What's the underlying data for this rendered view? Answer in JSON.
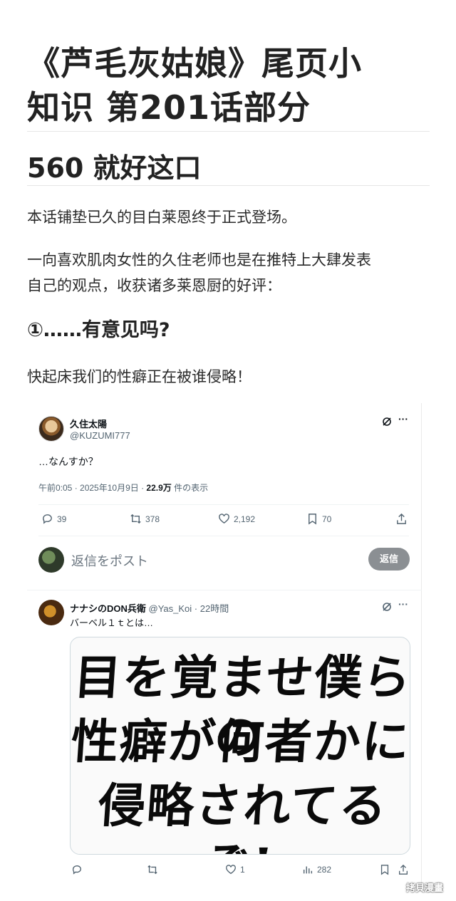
{
  "article": {
    "title_line1": "《芦毛灰姑娘》尾页小",
    "title_line2": "知识 第201话部分",
    "section_heading": "560 就好这口",
    "para1": "本话铺垫已久的目白莱恩终于正式登场。",
    "para2_line1": "一向喜欢肌肉女性的久住老师也是在推特上大肆发表",
    "para2_line2": "自己的观点，收获诸多莱恩厨的好评：",
    "sub_heading": "①……有意见吗?",
    "para3": "快起床我们的性癖正在被谁侵略！"
  },
  "tweet": {
    "author_name": "久住太陽",
    "author_handle": "@KUZUMI777",
    "text": "…なんすか？",
    "meta_time": "午前0:05 · 2025年10月9日 · ",
    "views": "22.9万",
    "views_suffix": " 件の表示",
    "replies": "39",
    "retweets": "378",
    "likes": "2,192",
    "bookmarks": "70",
    "reply_placeholder": "返信をポスト",
    "reply_button": "返信"
  },
  "reply_tweet": {
    "author_name": "ナナシのDON兵衛",
    "author_handle": "@Yas_Koi",
    "time": "· 22時間",
    "text": "バーベル１ｔとは…",
    "image_text": [
      "目を覚ませ僕らの",
      "性癖が何者かに",
      "侵略されてるぞ!"
    ],
    "likes": "1",
    "views": "282"
  },
  "watermark": "拷貝漫畫",
  "colors": {
    "reply_button_bg": "#8b8f93",
    "secondary_text": "#536471"
  }
}
